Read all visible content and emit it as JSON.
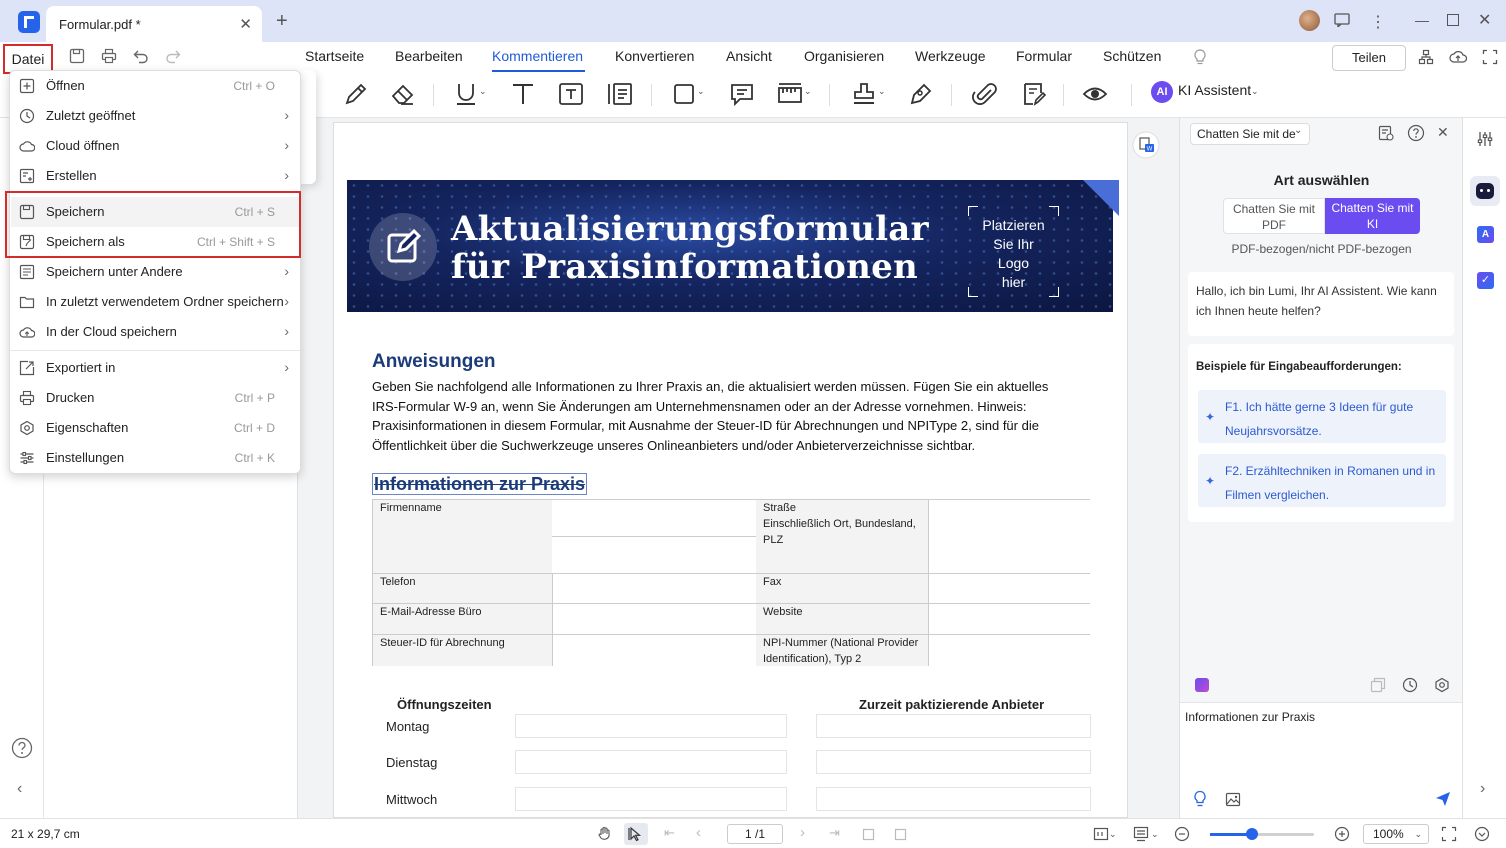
{
  "window": {
    "tab_title": "Formular.pdf *"
  },
  "menu": {
    "datei": "Datei",
    "items": [
      "Startseite",
      "Bearbeiten",
      "Kommentieren",
      "Konvertieren",
      "Ansicht",
      "Organisieren",
      "Werkzeuge",
      "Formular",
      "Schützen"
    ],
    "active": "Kommentieren",
    "teilen": "Teilen"
  },
  "ai_assistant": {
    "badge": "AI",
    "label": "KI Assistent"
  },
  "file_menu": {
    "items": [
      {
        "label": "Öffnen",
        "shortcut": "Ctrl + O",
        "submenu": false,
        "icon": "plus-square-icon"
      },
      {
        "label": "Zuletzt geöffnet",
        "shortcut": "",
        "submenu": true,
        "icon": "clock-icon"
      },
      {
        "label": "Cloud öffnen",
        "shortcut": "",
        "submenu": true,
        "icon": "cloud-icon"
      },
      {
        "label": "Erstellen",
        "shortcut": "",
        "submenu": true,
        "icon": "create-doc-icon"
      },
      {
        "label": "Speichern",
        "shortcut": "Ctrl + S",
        "submenu": false,
        "icon": "save-icon"
      },
      {
        "label": "Speichern als",
        "shortcut": "Ctrl + Shift + S",
        "submenu": false,
        "icon": "save-as-icon"
      },
      {
        "label": "Speichern unter Andere",
        "shortcut": "",
        "submenu": true,
        "icon": "save-other-icon"
      },
      {
        "label": "In zuletzt verwendetem Ordner speichern",
        "shortcut": "",
        "submenu": true,
        "icon": "folder-icon"
      },
      {
        "label": "In der Cloud speichern",
        "shortcut": "",
        "submenu": true,
        "icon": "cloud-upload-icon"
      },
      {
        "label": "Exportiert in",
        "shortcut": "",
        "submenu": true,
        "icon": "export-icon"
      },
      {
        "label": "Drucken",
        "shortcut": "Ctrl + P",
        "submenu": false,
        "icon": "print-icon"
      },
      {
        "label": "Eigenschaften",
        "shortcut": "Ctrl + D",
        "submenu": false,
        "icon": "properties-icon"
      },
      {
        "label": "Einstellungen",
        "shortcut": "Ctrl + K",
        "submenu": false,
        "icon": "settings-icon"
      }
    ]
  },
  "document": {
    "banner_title_1": "Aktualisierungsformular",
    "banner_title_2": "für Praxisinformationen",
    "logo_placeholder": [
      "Platzieren",
      "Sie Ihr",
      "Logo",
      "hier"
    ],
    "anweisungen_heading": "Anweisungen",
    "anweisungen_lines": [
      "Geben Sie nachfolgend alle Informationen zu Ihrer Praxis an, die aktualisiert werden müssen. Fügen Sie ein aktuelles",
      "IRS-Formular W-9 an, wenn Sie Änderungen am Unternehmensnamen oder an der Adresse vornehmen. Hinweis:",
      "Praxisinformationen in diesem Formular, mit Ausnahme der Steuer-ID für Abrechnungen und NPIType 2, sind für die",
      "Öffentlichkeit über die Suchwerkzeuge unseres Onlineanbieters und/oder Anbieterverzeichnisse sichtbar."
    ],
    "info_heading": "Informationen zur Praxis",
    "fields": {
      "firmenname": "Firmenname",
      "strasse": [
        "Straße",
        "Einschließlich Ort, Bundesland,",
        "PLZ"
      ],
      "telefon": "Telefon",
      "fax": "Fax",
      "email": "E-Mail-Adresse Büro",
      "website": "Website",
      "steuer_id": "Steuer-ID für Abrechnung",
      "npi": [
        "NPI-Nummer (National Provider",
        "Identification), Typ 2"
      ]
    },
    "hours_heading": "Öffnungszeiten",
    "providers_heading": "Zurzeit paktizierende Anbieter",
    "days": [
      "Montag",
      "Dienstag",
      "Mittwoch"
    ]
  },
  "ai_panel": {
    "chat_select": "Chatten Sie mit de",
    "art_title": "Art auswählen",
    "option_pdf": [
      "Chatten Sie mit",
      "PDF"
    ],
    "option_ki": [
      "Chatten Sie mit",
      "KI"
    ],
    "pdf_bezogen": "PDF-bezogen/nicht PDF-bezogen",
    "greeting": "Hallo, ich bin Lumi, Ihr AI Assistent. Wie kann ich Ihnen heute helfen?",
    "examples_title": "Beispiele für Eingabeaufforderungen:",
    "examples": [
      "F1. Ich hätte gerne 3 Ideen für gute Neujahrsvorsätze.",
      "F2. Erzähltechniken in Romanen und in Filmen vergleichen."
    ],
    "input_text": "Informationen zur Praxis"
  },
  "status": {
    "dimensions": "21 x 29,7 cm",
    "page": "1 /1",
    "zoom": "100%",
    "zoom_fraction": 0.4
  },
  "colors": {
    "accent": "#2563eb",
    "ai_purple": "#6a4cf0",
    "highlight_red": "#d42b2b",
    "heading_blue": "#1b3b7a"
  }
}
